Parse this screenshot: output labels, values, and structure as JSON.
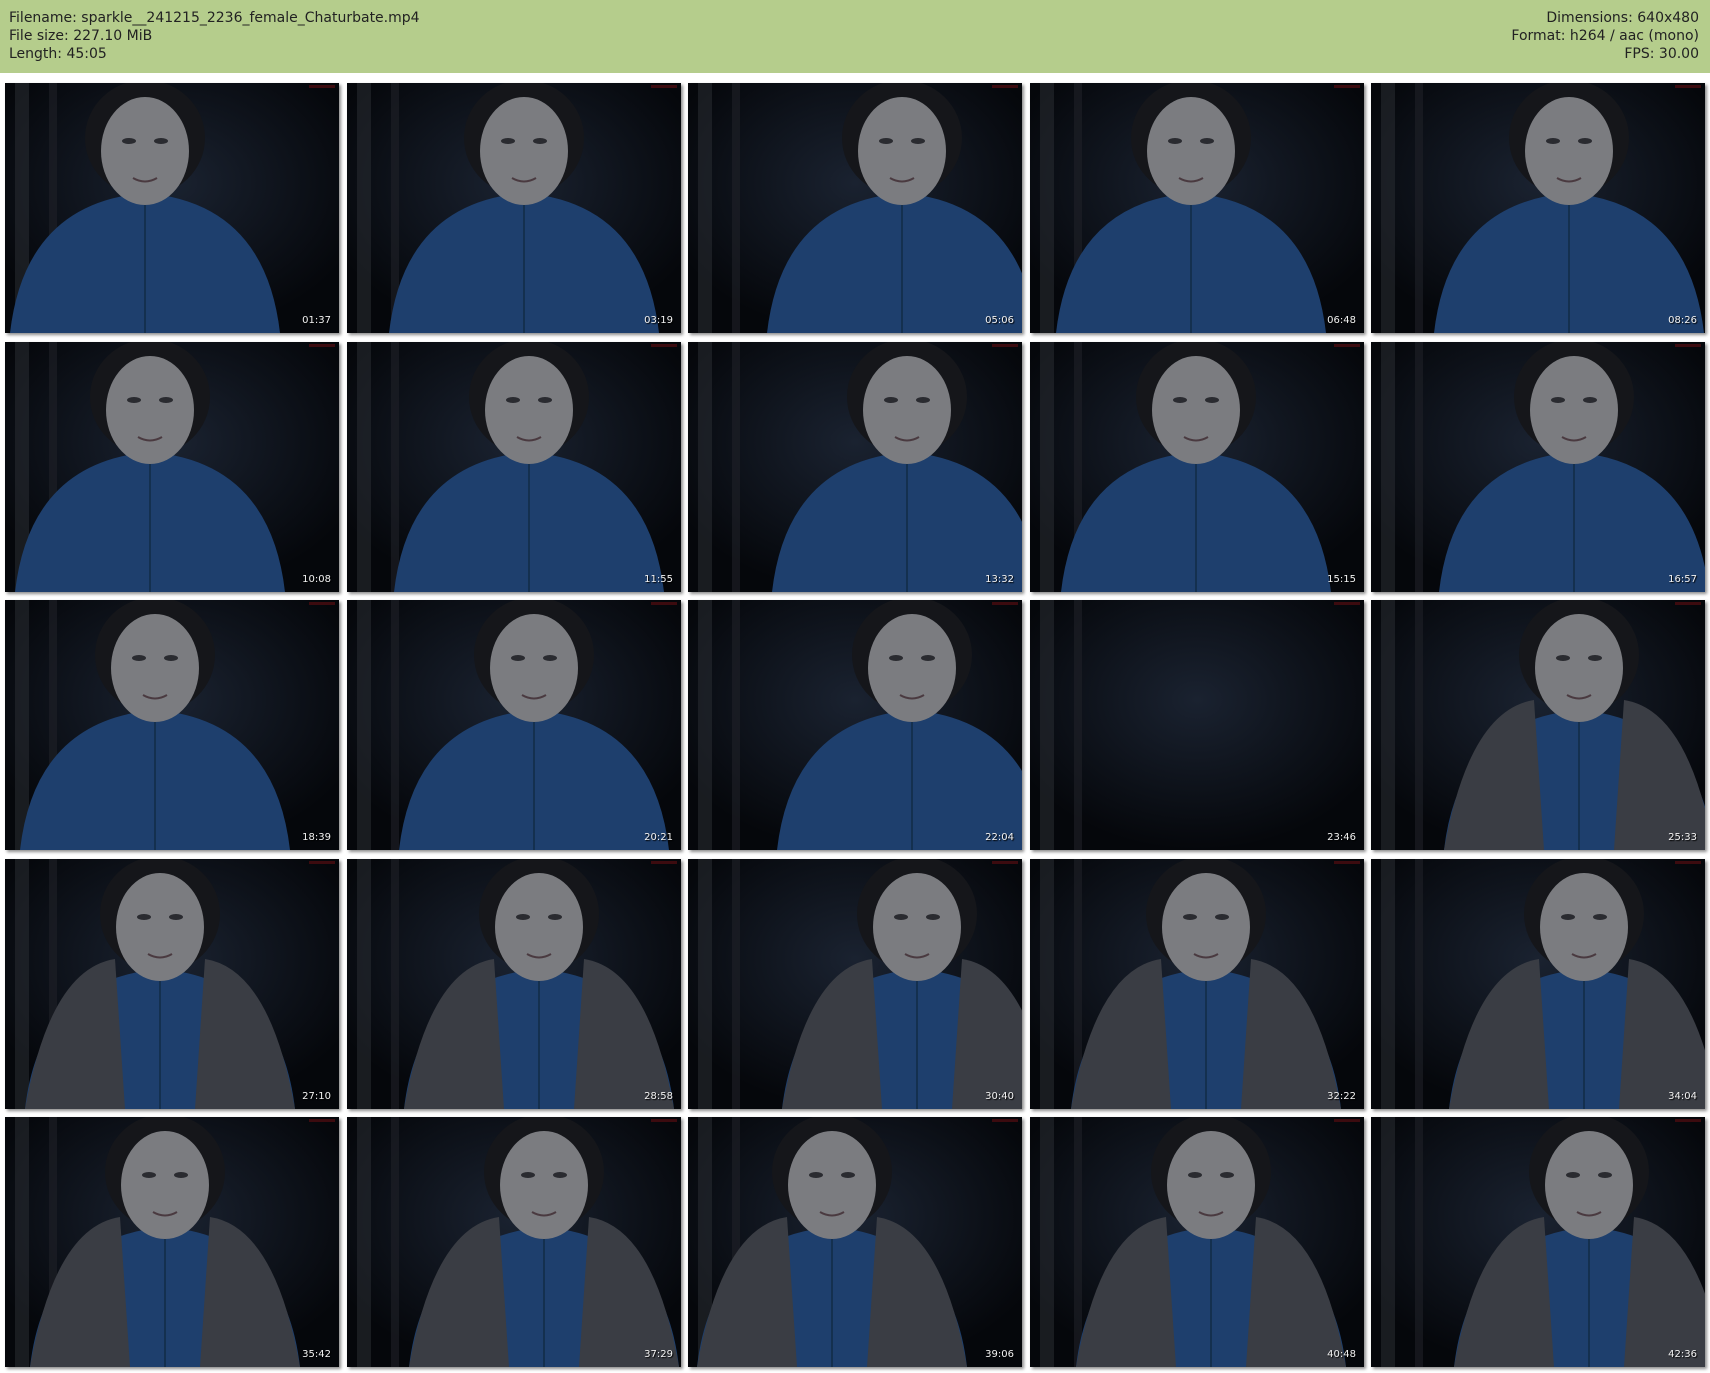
{
  "header": {
    "background_color": "#b5cd8c",
    "left_lines": [
      "Filename: sparkle__241215_2236_female_Chaturbate.mp4",
      "File size: 227.10 MiB",
      "Length: 45:05"
    ],
    "right_lines": [
      "Dimensions: 640x480",
      "Format: h264 / aac (mono)",
      "FPS: 30.00"
    ]
  },
  "thumbnails": [
    {
      "timestamp": "01:37",
      "cardigan": false
    },
    {
      "timestamp": "03:19",
      "cardigan": false
    },
    {
      "timestamp": "05:06",
      "cardigan": false
    },
    {
      "timestamp": "06:48",
      "cardigan": false
    },
    {
      "timestamp": "08:26",
      "cardigan": false
    },
    {
      "timestamp": "10:08",
      "cardigan": false
    },
    {
      "timestamp": "11:55",
      "cardigan": false
    },
    {
      "timestamp": "13:32",
      "cardigan": false
    },
    {
      "timestamp": "15:15",
      "cardigan": false
    },
    {
      "timestamp": "16:57",
      "cardigan": false
    },
    {
      "timestamp": "18:39",
      "cardigan": false
    },
    {
      "timestamp": "20:21",
      "cardigan": false
    },
    {
      "timestamp": "22:04",
      "cardigan": false
    },
    {
      "timestamp": "23:46",
      "cardigan": false,
      "empty": true
    },
    {
      "timestamp": "25:33",
      "cardigan": true
    },
    {
      "timestamp": "27:10",
      "cardigan": true
    },
    {
      "timestamp": "28:58",
      "cardigan": true
    },
    {
      "timestamp": "30:40",
      "cardigan": true
    },
    {
      "timestamp": "32:22",
      "cardigan": true
    },
    {
      "timestamp": "34:04",
      "cardigan": true
    },
    {
      "timestamp": "35:42",
      "cardigan": true
    },
    {
      "timestamp": "37:29",
      "cardigan": true
    },
    {
      "timestamp": "39:06",
      "cardigan": true
    },
    {
      "timestamp": "40:48",
      "cardigan": true
    },
    {
      "timestamp": "42:36",
      "cardigan": true
    }
  ]
}
